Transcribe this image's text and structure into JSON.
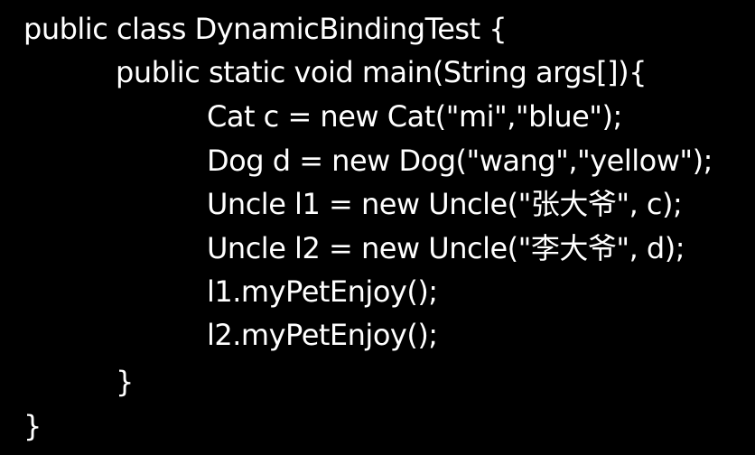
{
  "code": {
    "line1": "public class DynamicBindingTest {",
    "line2": "public static void main(String args[]){",
    "line3": "Cat c = new Cat(\"mi\",\"blue\");",
    "line4": "Dog d = new Dog(\"wang\",\"yellow\");",
    "line5": "Uncle l1 = new Uncle(\"张大爷\", c);",
    "line6": "Uncle l2 = new Uncle(\"李大爷\", d);",
    "line7": "l1.myPetEnjoy();",
    "line8": "l2.myPetEnjoy();",
    "line9": "}",
    "line10": "}"
  },
  "colors": {
    "background": "#000000",
    "text": "#ffffff"
  }
}
